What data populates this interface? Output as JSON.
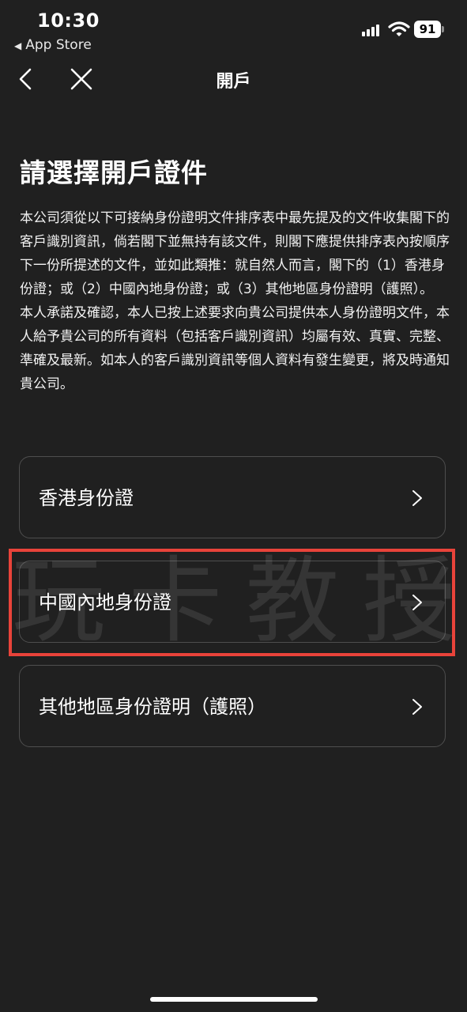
{
  "status": {
    "time": "10:30",
    "back_app": "App Store",
    "battery": "91"
  },
  "nav": {
    "title": "開戶"
  },
  "page": {
    "title": "請選擇開戶證件",
    "paragraph1": "本公司須從以下可接納身份證明文件排序表中最先提及的文件收集閣下的客戶識別資訊，倘若閣下並無持有該文件，則閣下應提供排序表內按順序下一份所提述的文件，並如此類推：就自然人而言，閣下的（1）香港身份證；或（2）中國內地身份證；或（3）其他地區身份證明（護照）。",
    "paragraph2": "本人承諾及確認，本人已按上述要求向貴公司提供本人身份證明文件，本人給予貴公司的所有資料（包括客戶識別資訊）均屬有效、真實、完整、準確及最新。如本人的客戶識別資訊等個人資料有發生變更，將及時通知貴公司。"
  },
  "options": [
    {
      "label": "香港身份證"
    },
    {
      "label": "中國內地身份證"
    },
    {
      "label": "其他地區身份證明（護照）"
    }
  ],
  "watermark": "玩卡教授",
  "colors": {
    "background": "#202020",
    "highlight": "#e8433a",
    "option_border": "#4e4e4e"
  }
}
